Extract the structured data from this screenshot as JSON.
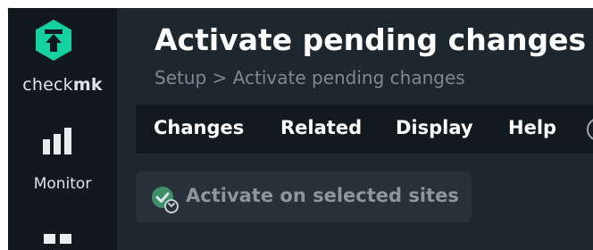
{
  "sidebar": {
    "logo": {
      "text_prefix": "check",
      "text_suffix": "mk",
      "icon": "checkmk-logo-icon",
      "color": "#15d1a0"
    },
    "items": [
      {
        "label": "Monitor",
        "icon": "bar-chart-icon"
      },
      {
        "label": "",
        "icon": "setup-grid-icon"
      }
    ]
  },
  "header": {
    "title": "Activate pending changes",
    "breadcrumb": "Setup > Activate pending changes"
  },
  "menu": {
    "items": [
      {
        "label": "Changes"
      },
      {
        "label": "Related"
      },
      {
        "label": "Display"
      },
      {
        "label": "Help"
      }
    ],
    "more_icon": "more-circle-icon"
  },
  "actions": {
    "activate_label": "Activate on selected sites",
    "activate_icon": "activate-sites-icon",
    "disabled": true
  },
  "colors": {
    "background": "#1e262e",
    "sidebar": "#11191f",
    "menubar": "#121a20",
    "accent": "#15d1a0",
    "text": "#ffffff",
    "muted": "#7c8a95"
  }
}
